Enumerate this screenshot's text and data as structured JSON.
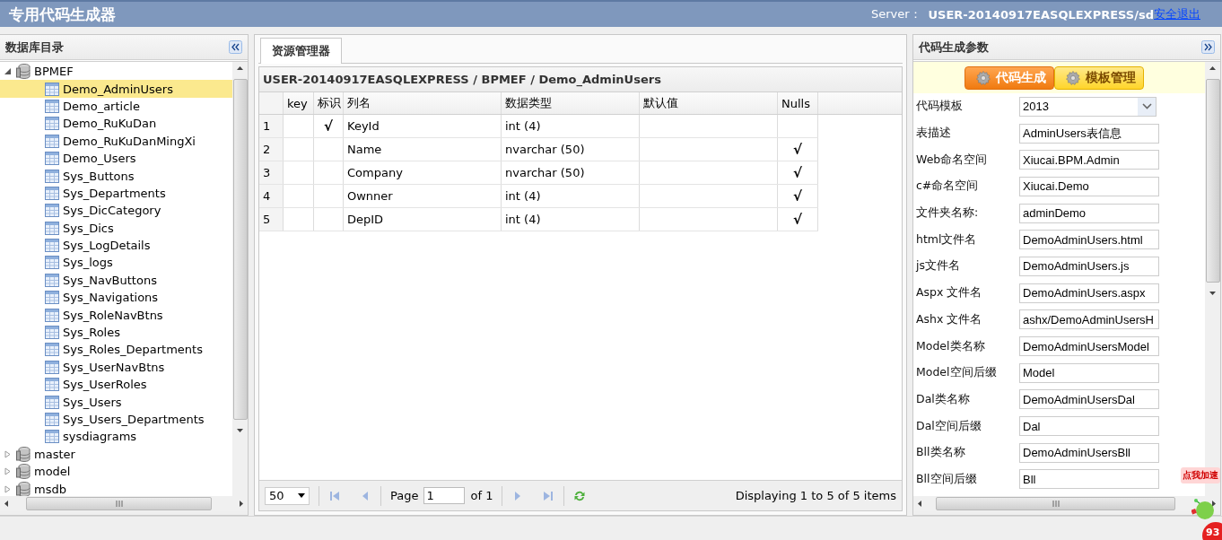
{
  "header": {
    "title": "专用代码生成器",
    "server_label": "Server：",
    "server": "USER-20140917EASQLEXPRESS/sd",
    "logout": "安全退出"
  },
  "left_panel": {
    "title": "数据库目录",
    "tree": [
      {
        "label": "BPMEF",
        "kind": "database",
        "expanded": true,
        "selected": false,
        "children": [
          {
            "label": "Demo_AdminUsers",
            "kind": "table",
            "selected": true
          },
          {
            "label": "Demo_article",
            "kind": "table",
            "selected": false
          },
          {
            "label": "Demo_RuKuDan",
            "kind": "table",
            "selected": false
          },
          {
            "label": "Demo_RuKuDanMingXi",
            "kind": "table",
            "selected": false
          },
          {
            "label": "Demo_Users",
            "kind": "table",
            "selected": false
          },
          {
            "label": "Sys_Buttons",
            "kind": "table",
            "selected": false
          },
          {
            "label": "Sys_Departments",
            "kind": "table",
            "selected": false
          },
          {
            "label": "Sys_DicCategory",
            "kind": "table",
            "selected": false
          },
          {
            "label": "Sys_Dics",
            "kind": "table",
            "selected": false
          },
          {
            "label": "Sys_LogDetails",
            "kind": "table",
            "selected": false
          },
          {
            "label": "Sys_logs",
            "kind": "table",
            "selected": false
          },
          {
            "label": "Sys_NavButtons",
            "kind": "table",
            "selected": false
          },
          {
            "label": "Sys_Navigations",
            "kind": "table",
            "selected": false
          },
          {
            "label": "Sys_RoleNavBtns",
            "kind": "table",
            "selected": false
          },
          {
            "label": "Sys_Roles",
            "kind": "table",
            "selected": false
          },
          {
            "label": "Sys_Roles_Departments",
            "kind": "table",
            "selected": false
          },
          {
            "label": "Sys_UserNavBtns",
            "kind": "table",
            "selected": false
          },
          {
            "label": "Sys_UserRoles",
            "kind": "table",
            "selected": false
          },
          {
            "label": "Sys_Users",
            "kind": "table",
            "selected": false
          },
          {
            "label": "Sys_Users_Departments",
            "kind": "table",
            "selected": false
          },
          {
            "label": "sysdiagrams",
            "kind": "table",
            "selected": false
          }
        ]
      },
      {
        "label": "master",
        "kind": "database",
        "expanded": false,
        "selected": false
      },
      {
        "label": "model",
        "kind": "database",
        "expanded": false,
        "selected": false
      },
      {
        "label": "msdb",
        "kind": "database",
        "expanded": false,
        "selected": false
      }
    ]
  },
  "center": {
    "tabs": [
      {
        "label": "资源管理器",
        "selected": true
      }
    ],
    "grid_title": "USER-20140917EASQLEXPRESS / BPMEF / Demo_AdminUsers",
    "columns": [
      "key",
      "标识",
      "列名",
      "数据类型",
      "默认值",
      "Nulls"
    ],
    "rows": [
      {
        "number": "1",
        "identity": "√",
        "name": "KeyId",
        "type": "int (4)"
      },
      {
        "number": "2",
        "name": "Name",
        "type": "nvarchar (50)",
        "nulls": "√"
      },
      {
        "number": "3",
        "name": "Company",
        "type": "nvarchar (50)",
        "nulls": "√"
      },
      {
        "number": "4",
        "name": "Ownner",
        "type": "int (4)",
        "nulls": "√"
      },
      {
        "number": "5",
        "name": "DepID",
        "type": "int (4)",
        "nulls": "√"
      }
    ],
    "pager": {
      "page_size": "50",
      "page_label": "Page",
      "page": "1",
      "of": "of 1",
      "display": "Displaying 1 to 5 of 5 items"
    }
  },
  "right_panel": {
    "title": "代码生成参数",
    "buttons": [
      {
        "label": "代码生成",
        "selected": true
      },
      {
        "label": "模板管理",
        "selected": false
      }
    ],
    "fields": [
      {
        "label": "代码模板",
        "value": "2013",
        "kind": "select"
      },
      {
        "label": "表描述",
        "value": "AdminUsers表信息",
        "kind": "text"
      },
      {
        "label": "Web命名空间",
        "value": "Xiucai.BPM.Admin",
        "kind": "text"
      },
      {
        "label": "c#命名空间",
        "value": "Xiucai.Demo",
        "kind": "text"
      },
      {
        "label": "文件夹名称:",
        "value": "adminDemo",
        "kind": "text"
      },
      {
        "label": "html文件名",
        "value": "DemoAdminUsers.html",
        "kind": "text"
      },
      {
        "label": "js文件名",
        "value": "DemoAdminUsers.js",
        "kind": "text"
      },
      {
        "label": "Aspx 文件名",
        "value": "DemoAdminUsers.aspx",
        "kind": "text"
      },
      {
        "label": "Ashx 文件名",
        "value": "ashx/DemoAdminUsersH",
        "kind": "text"
      },
      {
        "label": "Model类名称",
        "value": "DemoAdminUsersModel",
        "kind": "text"
      },
      {
        "label": "Model空间后缀",
        "value": "Model",
        "kind": "text"
      },
      {
        "label": "Dal类名称",
        "value": "DemoAdminUsersDal",
        "kind": "text"
      },
      {
        "label": "Dal空间后缀",
        "value": "Dal",
        "kind": "text"
      },
      {
        "label": "Bll类名称",
        "value": "DemoAdminUsersBll",
        "kind": "text"
      },
      {
        "label": "Bll空间后缀",
        "value": "Bll",
        "kind": "text"
      }
    ]
  },
  "widget": {
    "badge": "点我加速",
    "count": "93"
  }
}
